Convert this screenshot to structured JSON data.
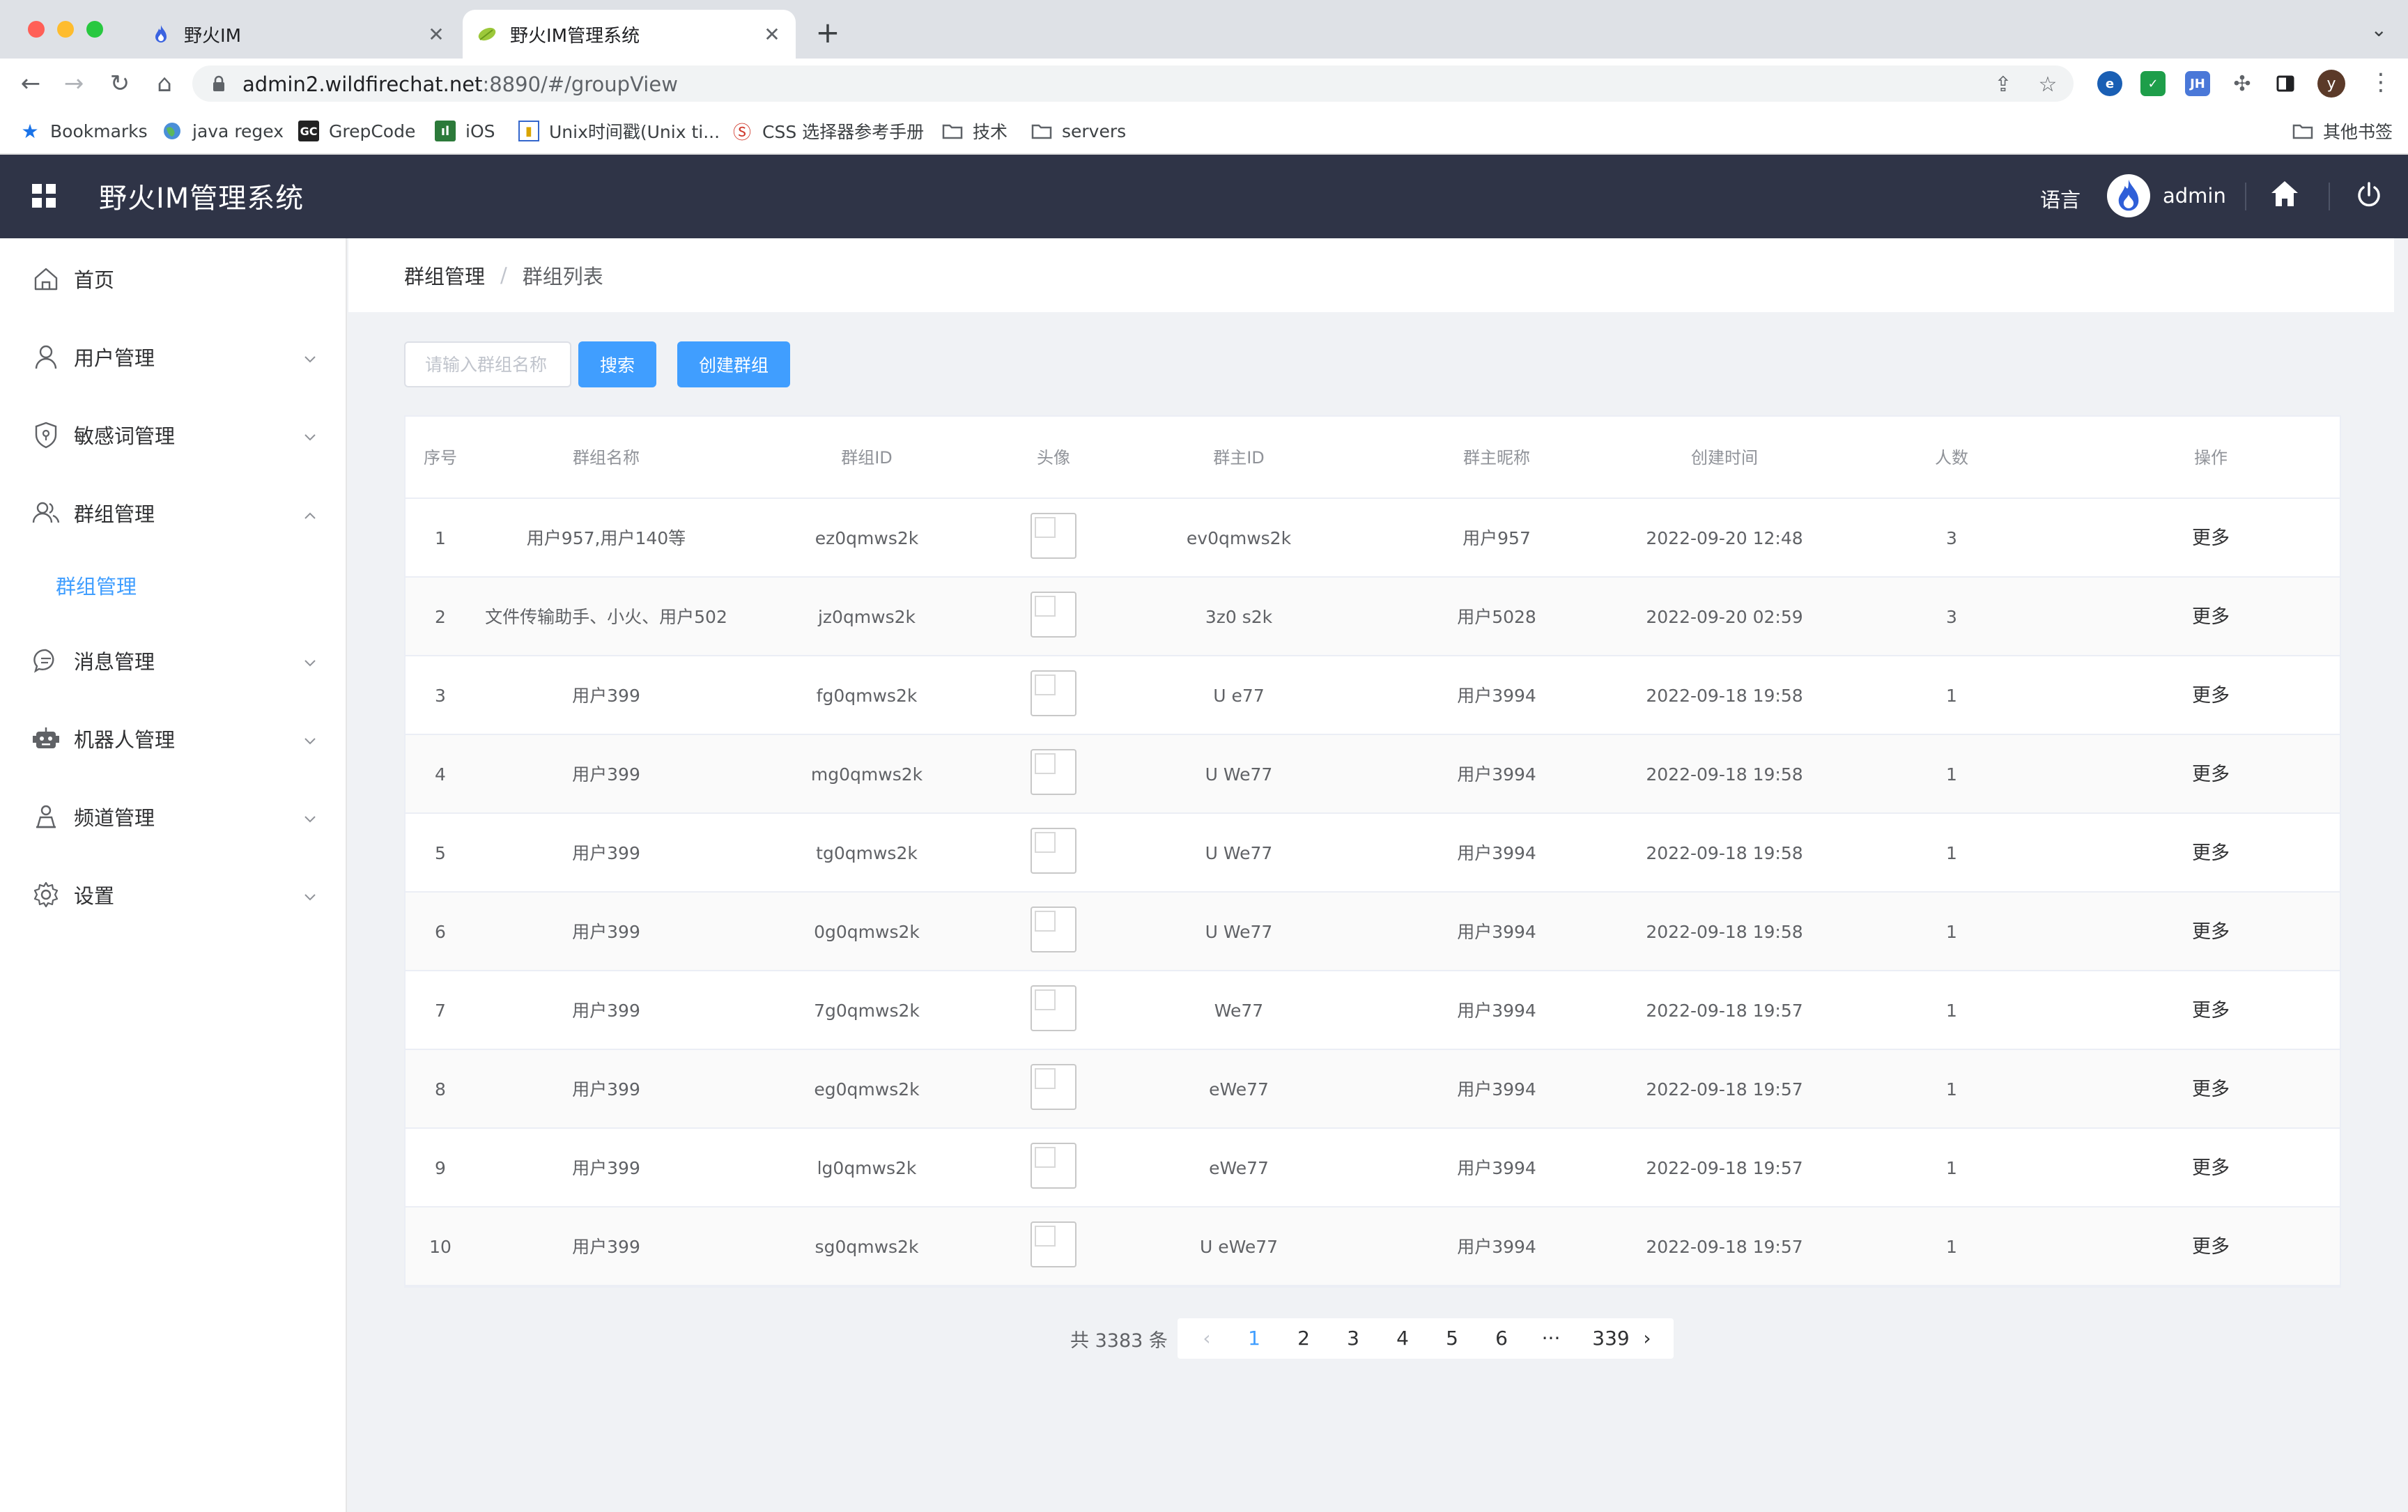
{
  "browser": {
    "tabs": [
      {
        "title": "野火IM",
        "active": false
      },
      {
        "title": "野火IM管理系统",
        "active": true
      }
    ],
    "url_host": "admin2.wildfirechat.net",
    "url_path": ":8890/#/groupView",
    "profile_initial": "y",
    "extensions": [
      "JH"
    ],
    "bookmarks": [
      {
        "label": "Bookmarks",
        "icon": "star-icon"
      },
      {
        "label": "java regex",
        "icon": "globe-icon"
      },
      {
        "label": "GrepCode",
        "icon": "gc-icon"
      },
      {
        "label": "iOS",
        "icon": "ios-icon"
      },
      {
        "label": "Unix时间戳(Unix ti...",
        "icon": "unix-icon"
      },
      {
        "label": "CSS 选择器参考手册",
        "icon": "css-icon"
      },
      {
        "label": "技术",
        "icon": "folder-icon"
      },
      {
        "label": "servers",
        "icon": "folder-icon"
      }
    ],
    "other_bookmarks": "其他书签"
  },
  "header": {
    "title": "野火IM管理系统",
    "language": "语言",
    "username": "admin"
  },
  "sidebar": {
    "items": [
      {
        "label": "首页",
        "icon": "home-icon"
      },
      {
        "label": "用户管理",
        "icon": "user-icon"
      },
      {
        "label": "敏感词管理",
        "icon": "shield-icon"
      },
      {
        "label": "群组管理",
        "icon": "group-icon",
        "expanded": true
      },
      {
        "label": "消息管理",
        "icon": "message-icon"
      },
      {
        "label": "机器人管理",
        "icon": "robot-icon"
      },
      {
        "label": "频道管理",
        "icon": "channel-icon"
      },
      {
        "label": "设置",
        "icon": "gear-icon"
      }
    ],
    "active_subitem": "群组管理"
  },
  "breadcrumb": [
    "群组管理",
    "群组列表"
  ],
  "search": {
    "placeholder": "请输入群组名称",
    "search_button": "搜索",
    "create_button": "创建群组"
  },
  "table": {
    "columns": [
      "序号",
      "群组名称",
      "群组ID",
      "头像",
      "群主ID",
      "群主昵称",
      "创建时间",
      "人数",
      "操作"
    ],
    "rows": [
      {
        "index": "1",
        "name": "用户957,用户140等",
        "group_id": "ez0qmws2k",
        "owner_id": "ev0qmws2k",
        "owner_name": "用户957",
        "created": "2022-09-20 12:48",
        "members": "3",
        "action": "更多"
      },
      {
        "index": "2",
        "name": "文件传输助手、小火、用户502",
        "group_id": "jz0qmws2k",
        "owner_id": "3z0 s2k",
        "owner_name": "用户5028",
        "created": "2022-09-20 02:59",
        "members": "3",
        "action": "更多"
      },
      {
        "index": "3",
        "name": "用户399",
        "group_id": "fg0qmws2k",
        "owner_id": "U e77",
        "owner_name": "用户3994",
        "created": "2022-09-18 19:58",
        "members": "1",
        "action": "更多"
      },
      {
        "index": "4",
        "name": "用户399",
        "group_id": "mg0qmws2k",
        "owner_id": "U We77",
        "owner_name": "用户3994",
        "created": "2022-09-18 19:58",
        "members": "1",
        "action": "更多"
      },
      {
        "index": "5",
        "name": "用户399",
        "group_id": "tg0qmws2k",
        "owner_id": "U We77",
        "owner_name": "用户3994",
        "created": "2022-09-18 19:58",
        "members": "1",
        "action": "更多"
      },
      {
        "index": "6",
        "name": "用户399",
        "group_id": "0g0qmws2k",
        "owner_id": "U We77",
        "owner_name": "用户3994",
        "created": "2022-09-18 19:58",
        "members": "1",
        "action": "更多"
      },
      {
        "index": "7",
        "name": "用户399",
        "group_id": "7g0qmws2k",
        "owner_id": "We77",
        "owner_name": "用户3994",
        "created": "2022-09-18 19:57",
        "members": "1",
        "action": "更多"
      },
      {
        "index": "8",
        "name": "用户399",
        "group_id": "eg0qmws2k",
        "owner_id": "eWe77",
        "owner_name": "用户3994",
        "created": "2022-09-18 19:57",
        "members": "1",
        "action": "更多"
      },
      {
        "index": "9",
        "name": "用户399",
        "group_id": "lg0qmws2k",
        "owner_id": "eWe77",
        "owner_name": "用户3994",
        "created": "2022-09-18 19:57",
        "members": "1",
        "action": "更多"
      },
      {
        "index": "10",
        "name": "用户399",
        "group_id": "sg0qmws2k",
        "owner_id": "U eWe77",
        "owner_name": "用户3994",
        "created": "2022-09-18 19:57",
        "members": "1",
        "action": "更多"
      }
    ]
  },
  "pagination": {
    "total_text": "共 3383 条",
    "pages": [
      "1",
      "2",
      "3",
      "4",
      "5",
      "6",
      "···",
      "339"
    ],
    "current": "1"
  },
  "colors": {
    "header_bg": "#2f3447",
    "accent": "#409eff",
    "page_bg": "#f0f2f5"
  }
}
